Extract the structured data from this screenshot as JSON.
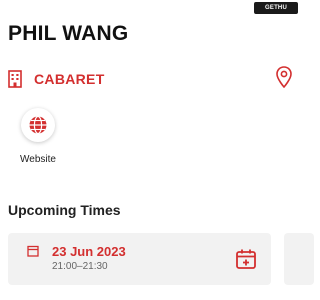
{
  "brand": {
    "badge_text": "GETHU"
  },
  "event": {
    "title": "PHIL WANG"
  },
  "venue": {
    "category_label": "CABARET"
  },
  "actions": {
    "website_label": "Website"
  },
  "upcoming": {
    "heading": "Upcoming Times",
    "items": [
      {
        "date": "23 Jun 2023",
        "time": "21:00–21:30"
      }
    ]
  },
  "icons": {
    "venue": "building-icon",
    "location": "map-pin-icon",
    "website": "globe-icon",
    "date": "calendar-icon",
    "add": "add-to-calendar-icon"
  },
  "colors": {
    "accent": "#d32f2f",
    "text": "#111111",
    "card_bg": "#f2f2f2"
  }
}
